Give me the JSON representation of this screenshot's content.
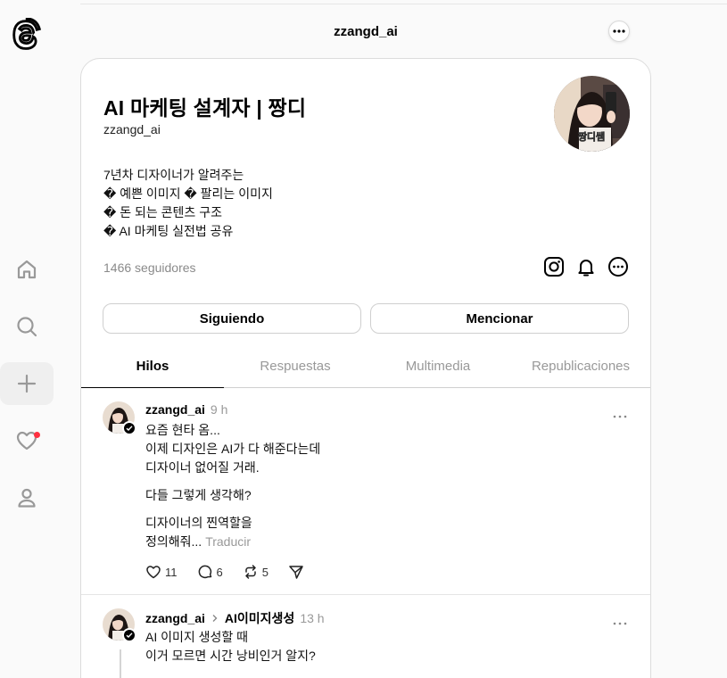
{
  "topbar": {
    "title": "zzangd_ai",
    "more_icon": "more-horizontal-icon",
    "logo": "threads-logo"
  },
  "nav": [
    {
      "name": "home",
      "icon": "home-icon"
    },
    {
      "name": "search",
      "icon": "search-icon"
    },
    {
      "name": "create",
      "icon": "plus-icon"
    },
    {
      "name": "activity",
      "icon": "heart-icon",
      "badge_color": "#ff3040"
    },
    {
      "name": "profile",
      "icon": "user-icon"
    }
  ],
  "profile": {
    "display_name": "AI 마케팅 설계자 | 짱디",
    "handle": "zzangd_ai",
    "avatar_badge": "짱디쌤",
    "bio": [
      "7년차 디자이너가 알려주는",
      "� 예쁜 이미지 � 팔리는 이미지",
      "� 돈 되는 콘텐츠 구조",
      "� AI 마케팅 실전법 공유"
    ],
    "followers": "1466 seguidores",
    "icons": [
      "instagram-icon",
      "bell-icon",
      "more-circle-icon"
    ],
    "buttons": {
      "following": "Siguiendo",
      "mention": "Mencionar"
    }
  },
  "tabs": [
    {
      "label": "Hilos",
      "active": true
    },
    {
      "label": "Respuestas",
      "active": false
    },
    {
      "label": "Multimedia",
      "active": false
    },
    {
      "label": "Republicaciones",
      "active": false
    }
  ],
  "posts": [
    {
      "user": "zzangd_ai",
      "time": "9 h",
      "lines_1": [
        "요즘 현타 옴...",
        "이제 디자인은 AI가 다 해준다는데",
        "디자이너 없어질 거래."
      ],
      "line_2": "다들 그렇게 생각해?",
      "line_3a": "디자이너의 찐역할을",
      "line_3b": "정의해줘...",
      "translate": "Traducir",
      "likes": "11",
      "comments": "6",
      "reposts": "5"
    },
    {
      "user": "zzangd_ai",
      "topic": "AI이미지생성",
      "time": "13 h",
      "lines": [
        "AI 이미지 생성할 때",
        "이거 모르면 시간 낭비인거 알지?"
      ]
    }
  ],
  "colors": {
    "accent": "#000000",
    "muted": "#999999",
    "badge": "#ff3040",
    "card_border": "#dcdcdc"
  }
}
